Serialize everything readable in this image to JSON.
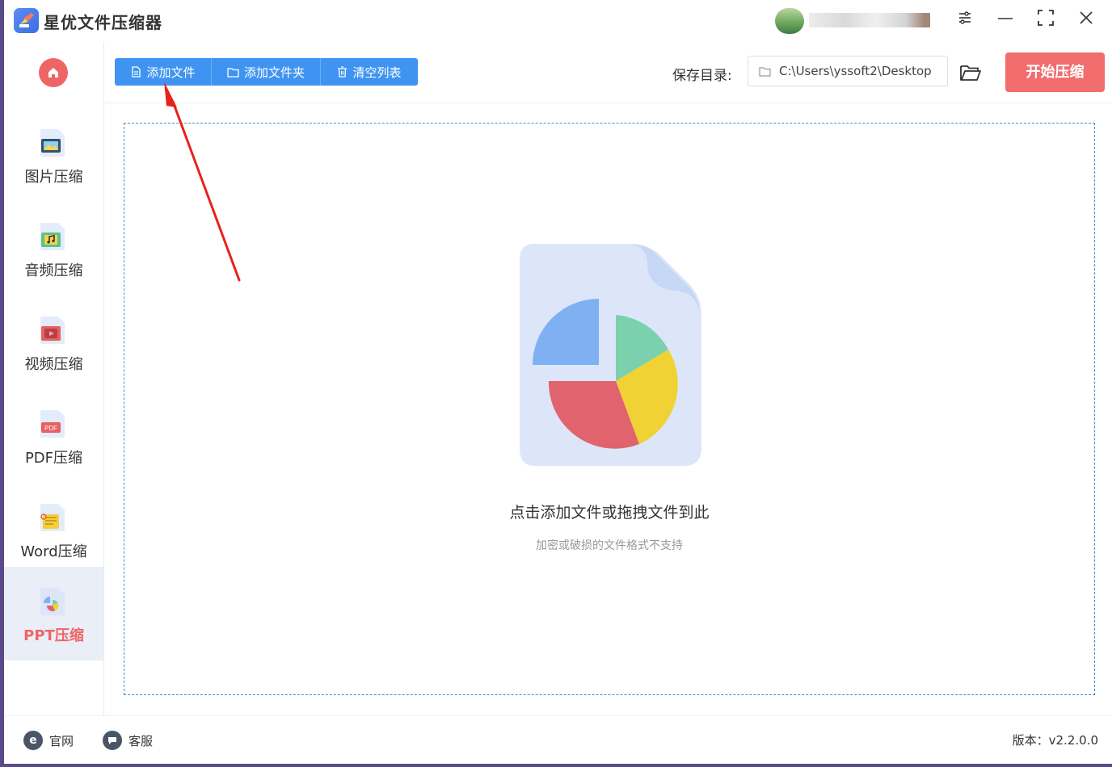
{
  "app": {
    "title": "星优文件压缩器"
  },
  "sidebar": {
    "items": [
      {
        "label": "图片压缩",
        "icon": "image-icon"
      },
      {
        "label": "音频压缩",
        "icon": "audio-icon"
      },
      {
        "label": "视频压缩",
        "icon": "video-icon"
      },
      {
        "label": "PDF压缩",
        "icon": "pdf-icon",
        "badge": "PDF"
      },
      {
        "label": "Word压缩",
        "icon": "word-icon"
      },
      {
        "label": "PPT压缩",
        "icon": "ppt-icon",
        "active": true
      }
    ]
  },
  "toolbar": {
    "add_file": "添加文件",
    "add_folder": "添加文件夹",
    "clear_list": "清空列表",
    "save_label": "保存目录:",
    "save_path": "C:\\Users\\yssoft2\\Desktop",
    "start": "开始压缩"
  },
  "dropzone": {
    "title": "点击添加文件或拖拽文件到此",
    "hint": "加密或破损的文件格式不支持"
  },
  "footer": {
    "website": "官网",
    "support": "客服",
    "version": "版本：v2.2.0.0"
  },
  "colors": {
    "primary_blue": "#3f94f1",
    "accent_red": "#f26d6d",
    "active_bg": "#eaeef7"
  }
}
